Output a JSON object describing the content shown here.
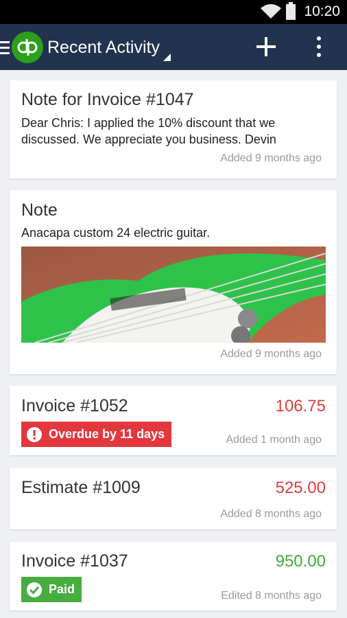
{
  "status_bar": {
    "time": "10:20",
    "icons": [
      "wifi-icon",
      "battery-icon"
    ]
  },
  "app_bar": {
    "title": "Recent Activity",
    "logo_text": "qb",
    "icons": [
      "menu-icon",
      "quickbooks-logo",
      "add-icon",
      "overflow-menu-icon"
    ]
  },
  "colors": {
    "app_bar": "#21334f",
    "logo": "#2ca01c",
    "overdue": "#e3373e",
    "paid": "#48ad40",
    "amount_red": "#e03c3e",
    "amount_green": "#3ea93a"
  },
  "activity": [
    {
      "title": "Note for Invoice #1047",
      "body": "Dear Chris:  I applied the 10% discount that we discussed.  We appreciate you business.  Devin",
      "meta": "Added 9 months ago"
    },
    {
      "title": "Note",
      "body": "Anacapa custom 24 electric guitar.",
      "image": "electric-guitar-photo",
      "meta": "Added 9 months ago"
    },
    {
      "title": "Invoice #1052",
      "amount": "106.75",
      "badge": "Overdue by 11 days",
      "badge_icon": "alert-icon",
      "meta": "Added 1 month ago"
    },
    {
      "title": "Estimate #1009",
      "amount": "525.00",
      "meta": "Added 8 months ago"
    },
    {
      "title": "Invoice #1037",
      "amount": "950.00",
      "badge": "Paid",
      "badge_icon": "check-icon",
      "meta": "Edited 8 months ago"
    }
  ]
}
